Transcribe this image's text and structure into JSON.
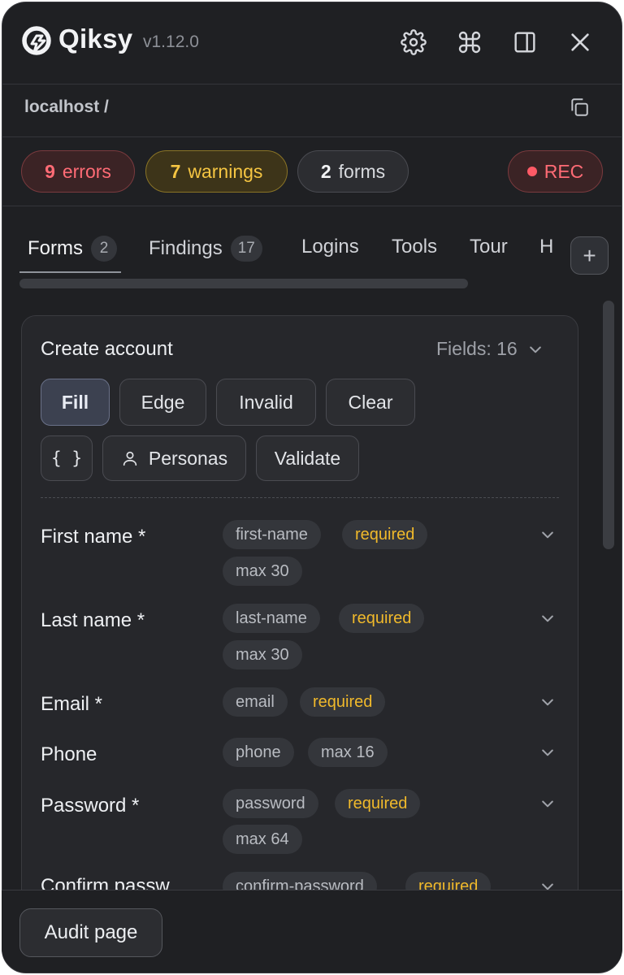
{
  "app": {
    "name": "Qiksy",
    "version": "v1.12.0"
  },
  "url": "localhost /",
  "status": {
    "errors": {
      "count": "9",
      "label": "errors"
    },
    "warnings": {
      "count": "7",
      "label": "warnings"
    },
    "forms": {
      "count": "2",
      "label": "forms"
    },
    "rec_label": "REC"
  },
  "tabs": [
    {
      "label": "Forms",
      "count": "2"
    },
    {
      "label": "Findings",
      "count": "17"
    },
    {
      "label": "Logins"
    },
    {
      "label": "Tools"
    },
    {
      "label": "Tour"
    },
    {
      "label": "H"
    }
  ],
  "add_tab_label": "+",
  "form": {
    "title": "Create account",
    "fields_summary": "Fields: 16",
    "actions": {
      "fill": "Fill",
      "edge": "Edge",
      "invalid": "Invalid",
      "clear": "Clear",
      "json": "{ }",
      "personas": "Personas",
      "validate": "Validate"
    },
    "rows": [
      {
        "label": "First name *",
        "chips": [
          "first-name",
          "required",
          "max 30"
        ]
      },
      {
        "label": "Last name *",
        "chips": [
          "last-name",
          "required",
          "max 30"
        ]
      },
      {
        "label": "Email *",
        "chips": [
          "email",
          "required"
        ]
      },
      {
        "label": "Phone",
        "chips": [
          "phone",
          "max 16"
        ]
      },
      {
        "label": "Password *",
        "chips": [
          "password",
          "required",
          "max 64"
        ]
      },
      {
        "label": "Confirm passw",
        "chips": [
          "confirm-password",
          "required"
        ]
      }
    ]
  },
  "footer": {
    "audit_label": "Audit page"
  },
  "colors": {
    "background": "#1f2023",
    "error": "#ff6b75",
    "warning": "#f5c542",
    "required": "#f0b92b"
  }
}
